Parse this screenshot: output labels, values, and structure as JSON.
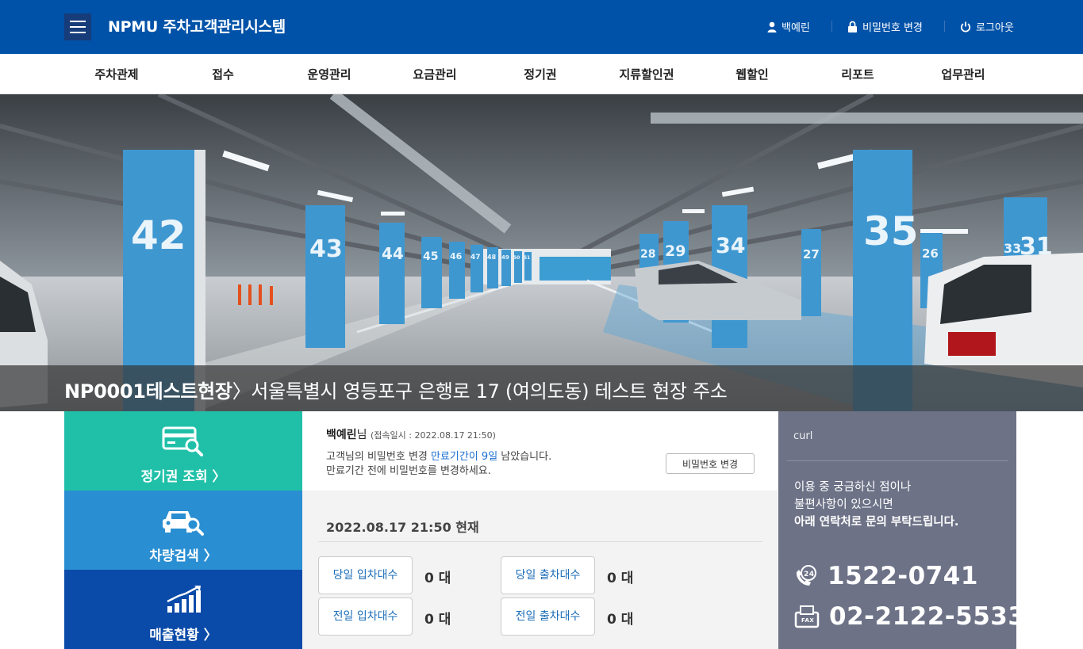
{
  "header": {
    "title": "NPMU 주차고객관리시스템",
    "user_name": "백예린",
    "change_password": "비밀번호 변경",
    "logout": "로그아웃"
  },
  "nav": {
    "items": [
      "주차관제",
      "접수",
      "운영관리",
      "요금관리",
      "정기권",
      "지류할인권",
      "웹할인",
      "리포트",
      "업무관리"
    ]
  },
  "hero": {
    "site_code_name": "NP0001테스트현장",
    "separator": "〉",
    "address": "서울특별시 영등포구 은행로 17 (여의도동) 테스트 현장 주소",
    "pillar_numbers": [
      "42",
      "43",
      "44",
      "45",
      "46",
      "47",
      "48",
      "49",
      "50",
      "51",
      "28",
      "29",
      "34",
      "35",
      "27",
      "26",
      "33",
      "31"
    ]
  },
  "quick_menu": [
    {
      "label": "정기권 조회 〉",
      "icon": "card-search-icon",
      "color": "#20c0a8"
    },
    {
      "label": "차량검색 〉",
      "icon": "car-search-icon",
      "color": "#2a8ed2"
    },
    {
      "label": "매출현황 〉",
      "icon": "bar-chart-icon",
      "color": "#0a4aa8"
    }
  ],
  "info": {
    "name": "백예린",
    "name_suffix": "님",
    "login_time": "(접속일시 : 2022.08.17 21:50)",
    "msg_prefix": "고객님의 비밀번호 변경 ",
    "msg_highlight": "만료기간이 9일",
    "msg_suffix": " 남았습니다.",
    "msg_line2": "만료기간 전에 비밀번호를 변경하세요.",
    "button": "비밀번호 변경"
  },
  "stats": {
    "title": "2022.08.17 21:50 현재",
    "items": [
      {
        "label": "당일 입차대수",
        "value": "0 대"
      },
      {
        "label": "당일 출차대수",
        "value": "0 대"
      },
      {
        "label": "전일 입차대수",
        "value": "0 대"
      },
      {
        "label": "전일 출차대수",
        "value": "0 대"
      }
    ]
  },
  "contact": {
    "id": "curl",
    "line1": "이용 중 궁금하신 점이나",
    "line2": "불편사항이 있으시면",
    "line3": "아래 연락처로 문의 부탁드립니다.",
    "phone": "1522-0741",
    "fax": "02-2122-5533"
  }
}
